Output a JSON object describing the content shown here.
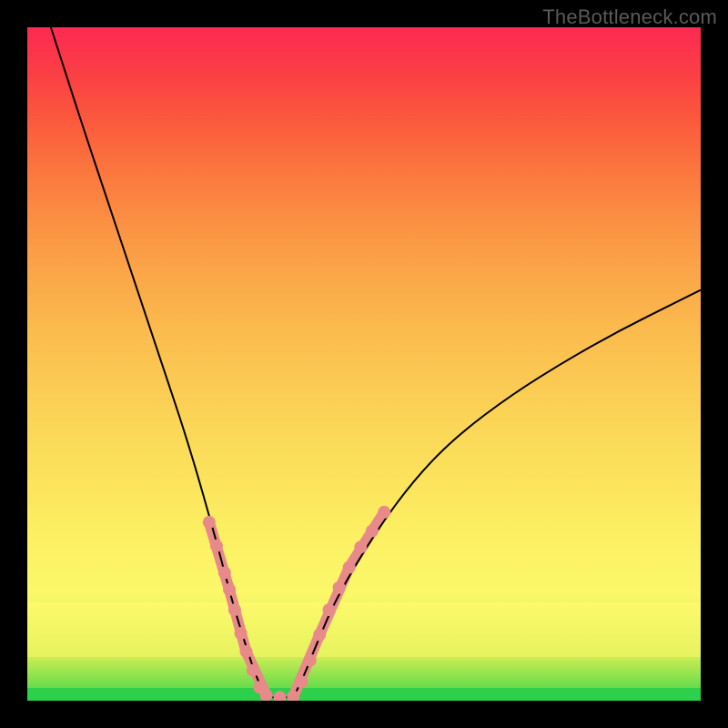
{
  "watermark": "TheBottleneck.com",
  "chart_data": {
    "type": "line",
    "title": "",
    "xlabel": "",
    "ylabel": "",
    "xlim": [
      0,
      1
    ],
    "ylim": [
      0,
      1
    ],
    "background_gradient": [
      "#2dd04a",
      "#fbf86a",
      "#fb3f44",
      "#fc2a52"
    ],
    "series": [
      {
        "name": "left-curve",
        "color": "#000000",
        "x": [
          0.035,
          0.08,
          0.12,
          0.16,
          0.2,
          0.24,
          0.28,
          0.305,
          0.325,
          0.34,
          0.355
        ],
        "y": [
          1.0,
          0.86,
          0.74,
          0.62,
          0.5,
          0.38,
          0.24,
          0.145,
          0.08,
          0.035,
          0.005
        ]
      },
      {
        "name": "right-curve",
        "color": "#000000",
        "x": [
          0.395,
          0.41,
          0.43,
          0.46,
          0.52,
          0.58,
          0.64,
          0.72,
          0.8,
          0.88,
          0.96,
          1.0
        ],
        "y": [
          0.005,
          0.035,
          0.085,
          0.155,
          0.255,
          0.335,
          0.395,
          0.455,
          0.505,
          0.55,
          0.59,
          0.61
        ]
      },
      {
        "name": "valley-floor",
        "color": "#000000",
        "x": [
          0.355,
          0.395
        ],
        "y": [
          0.005,
          0.005
        ]
      }
    ],
    "markers": [
      {
        "name": "left-dots",
        "color": "#e88a8a",
        "radius": 7,
        "points": [
          [
            0.27,
            0.265
          ],
          [
            0.281,
            0.23
          ],
          [
            0.293,
            0.19
          ],
          [
            0.3,
            0.165
          ],
          [
            0.308,
            0.135
          ],
          [
            0.317,
            0.1
          ],
          [
            0.325,
            0.073
          ],
          [
            0.335,
            0.045
          ],
          [
            0.345,
            0.02
          ],
          [
            0.355,
            0.008
          ],
          [
            0.375,
            0.005
          ]
        ]
      },
      {
        "name": "right-dots",
        "color": "#e88a8a",
        "radius": 7,
        "points": [
          [
            0.395,
            0.006
          ],
          [
            0.407,
            0.028
          ],
          [
            0.42,
            0.06
          ],
          [
            0.434,
            0.098
          ],
          [
            0.448,
            0.135
          ],
          [
            0.463,
            0.168
          ],
          [
            0.478,
            0.198
          ],
          [
            0.495,
            0.228
          ],
          [
            0.512,
            0.252
          ],
          [
            0.53,
            0.28
          ]
        ]
      }
    ],
    "marker_segments": [
      {
        "name": "left-thick",
        "color": "#e88a8a",
        "width": 12,
        "points": [
          [
            0.27,
            0.265
          ],
          [
            0.3,
            0.165
          ],
          [
            0.325,
            0.073
          ],
          [
            0.355,
            0.008
          ]
        ]
      },
      {
        "name": "right-thick",
        "color": "#e88a8a",
        "width": 12,
        "points": [
          [
            0.395,
            0.006
          ],
          [
            0.434,
            0.098
          ],
          [
            0.478,
            0.198
          ],
          [
            0.53,
            0.28
          ]
        ]
      }
    ]
  }
}
